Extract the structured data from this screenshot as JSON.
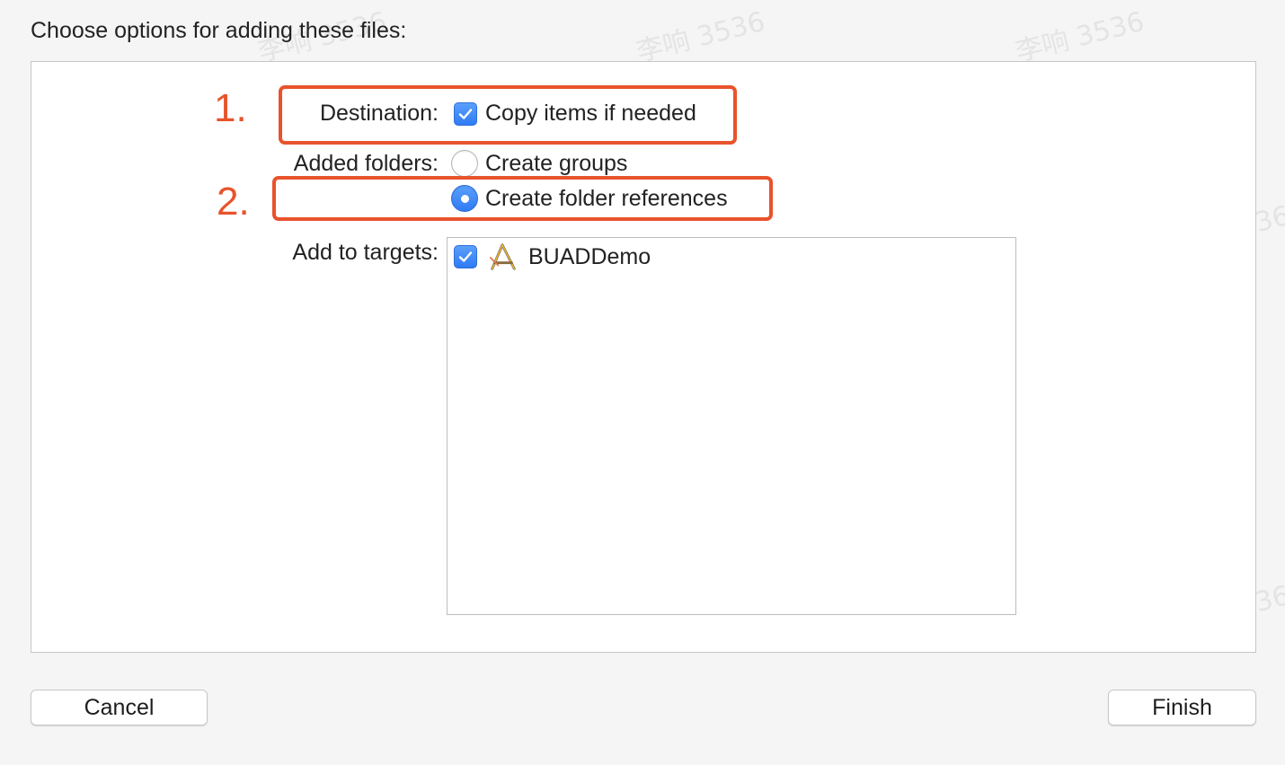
{
  "header": {
    "title": "Choose options for adding these files:"
  },
  "destination": {
    "label": "Destination:",
    "option_label": "Copy items if needed",
    "checked": true
  },
  "added_folders": {
    "label": "Added folders:",
    "options": [
      {
        "label": "Create groups",
        "selected": false
      },
      {
        "label": "Create folder references",
        "selected": true
      }
    ]
  },
  "targets": {
    "label": "Add to targets:",
    "items": [
      {
        "name": "BUADDemo",
        "checked": true,
        "icon": "xcode-app-icon"
      }
    ]
  },
  "annotations": {
    "first": "1.",
    "second": "2.",
    "color": "#e8532c"
  },
  "buttons": {
    "cancel": "Cancel",
    "finish": "Finish"
  },
  "watermark": "李响 3536",
  "colors": {
    "accent": "#2f7bf5",
    "annotation": "#e8532c"
  }
}
